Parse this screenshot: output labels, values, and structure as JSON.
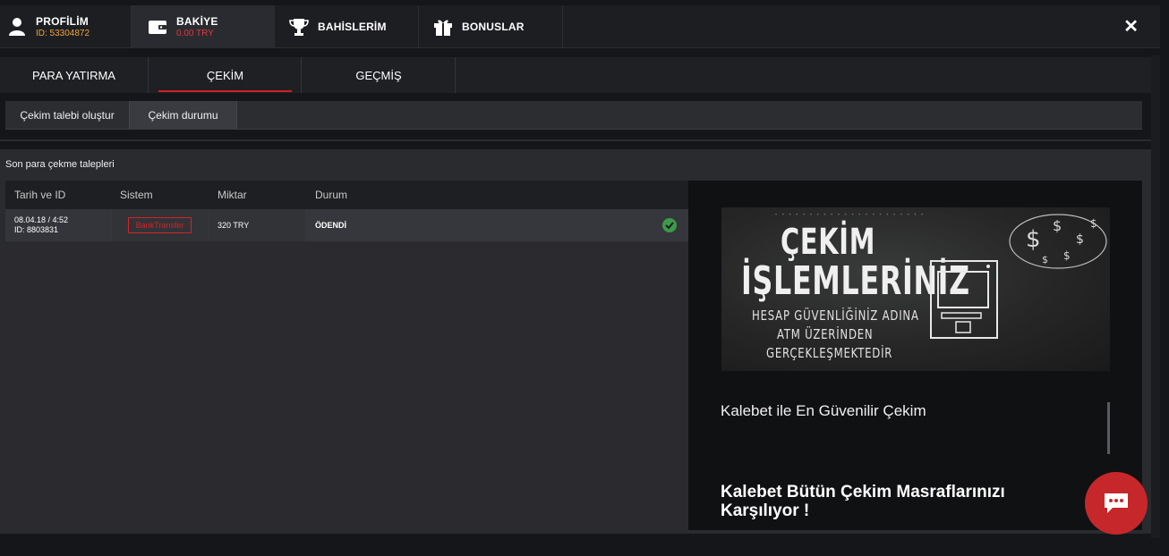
{
  "topbar": {
    "tabs": [
      {
        "title": "PROFİLİM",
        "sub": "ID: 53304872",
        "icon": "user-icon"
      },
      {
        "title": "BAKİYE",
        "sub": "0.00 TRY",
        "icon": "wallet-icon"
      },
      {
        "title": "BAHİSLERİM",
        "icon": "trophy-icon"
      },
      {
        "title": "BONUSLAR",
        "icon": "gift-icon"
      }
    ],
    "close": "✕"
  },
  "subnav": {
    "tabs": [
      "PARA YATIRMA",
      "ÇEKİM",
      "GEÇMİŞ"
    ],
    "active": "ÇEKİM"
  },
  "thirdnav": {
    "tabs": [
      "Çekim talebi oluştur",
      "Çekim durumu"
    ],
    "active": "Çekim durumu"
  },
  "panel": {
    "title": "Son para çekme talepleri",
    "columns": [
      "Tarih ve ID",
      "Sistem",
      "Miktar",
      "Durum"
    ],
    "rows": [
      {
        "date": "08.04.18 / 4:52",
        "id": "ID: 8803831",
        "system": "BankTransfer",
        "amount": "320 TRY",
        "status": "ÖDENDİ"
      }
    ]
  },
  "promo": {
    "banner": {
      "line1": "ÇEKİM",
      "line2": "İŞLEMLERİNİZ",
      "line3": "HESAP GÜVENLİĞİNİZ ADINA",
      "line4": "ATM ÜZERİNDEN",
      "line5": "GERÇEKLEŞMEKTEDİR",
      "dots": "• • • • • • • • • • • • • • • • • • • • • •"
    },
    "text1": "Kalebet ile En Güvenilir Çekim",
    "text2": "Kalebet Bütün Çekim Masraflarınızı Karşılıyor !"
  },
  "colors": {
    "accent": "#d11f26",
    "balance": "#e0393e",
    "id": "#f0a63a",
    "success": "#3c9a4a"
  }
}
